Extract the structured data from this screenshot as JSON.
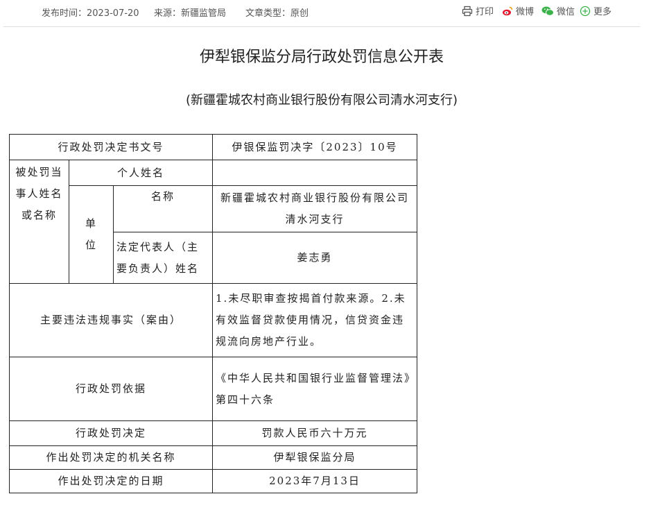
{
  "meta": {
    "date_label": "发布时间：",
    "date_value": "2023-07-20",
    "source_label": "来源：",
    "source_value": "新疆监管局",
    "type_label": "文章类型：",
    "type_value": "原创"
  },
  "share": {
    "print": "打印",
    "weibo": "微博",
    "wechat": "微信",
    "more": "更多",
    "icons": [
      "printer-icon",
      "weibo-icon",
      "wechat-icon",
      "plus-circle-icon"
    ],
    "colors": {
      "weibo": "#e6162d",
      "wechat": "#3bb34a",
      "more": "#3bb34a"
    }
  },
  "title": "伊犁银保监分局行政处罚信息公开表",
  "subtitle": "(新疆霍城农村商业银行股份有限公司清水河支行)",
  "table": {
    "doc_no_label": "行政处罚决定书文号",
    "doc_no_value": "伊银保监罚决字〔2023〕10号",
    "party_label": "被处罚当事人姓名或名称",
    "person_label": "个人姓名",
    "person_value": "",
    "unit_label": "单位",
    "unit_name_label": "名称",
    "unit_name_value": "新疆霍城农村商业银行股份有限公司清水河支行",
    "legal_rep_label": "法定代表人（主要负责人）姓名",
    "legal_rep_value": "姜志勇",
    "facts_label": "主要违法违规事实（案由）",
    "facts_value": "1.未尽职审查按揭首付款来源。2.未有效监督贷款使用情况，信贷资金违规流向房地产行业。",
    "basis_label": "行政处罚依据",
    "basis_value": "《中华人民共和国银行业监督管理法》第四十六条",
    "decision_label": "行政处罚决定",
    "decision_value": "罚款人民币六十万元",
    "authority_label": "作出处罚决定的机关名称",
    "authority_value": "伊犁银保监分局",
    "date_label": "作出处罚决定的日期",
    "date_value": "2023年7月13日"
  }
}
